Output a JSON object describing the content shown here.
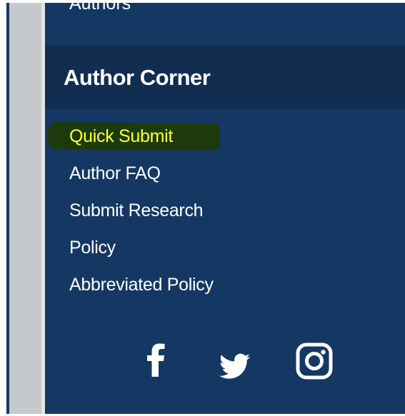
{
  "nav": {
    "previous_item": "Authors"
  },
  "author_corner": {
    "title": "Author Corner",
    "links": [
      {
        "label": "Quick Submit",
        "highlighted": true
      },
      {
        "label": "Author FAQ",
        "highlighted": false
      },
      {
        "label": "Submit Research",
        "highlighted": false
      },
      {
        "label": "Policy",
        "highlighted": false
      },
      {
        "label": "Abbreviated Policy",
        "highlighted": false
      }
    ]
  },
  "social": {
    "icons": [
      "facebook-icon",
      "twitter-icon",
      "instagram-icon"
    ]
  },
  "colors": {
    "panel_background": "#153763",
    "header_background": "#112d50",
    "highlight_text": "#ffff33",
    "highlight_marker": "#1c3a0c",
    "link_text": "#ffffff"
  }
}
